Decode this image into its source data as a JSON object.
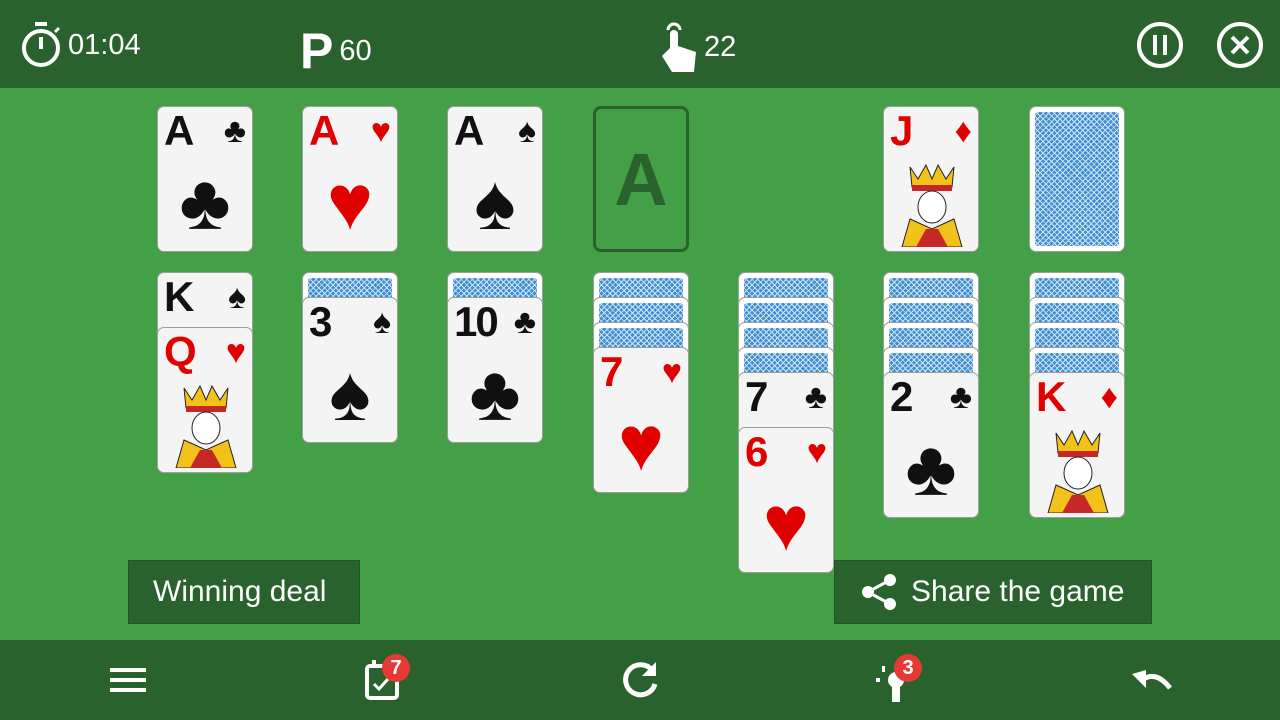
{
  "header": {
    "timer": "01:04",
    "points_label": "P",
    "points": "60",
    "moves": "22"
  },
  "foundations": [
    {
      "rank": "A",
      "suit": "♣",
      "color": "black"
    },
    {
      "rank": "A",
      "suit": "♥",
      "color": "red"
    },
    {
      "rank": "A",
      "suit": "♠",
      "color": "black"
    },
    {
      "empty": true,
      "label": "A"
    }
  ],
  "waste": {
    "rank": "J",
    "suit": "♦",
    "color": "red",
    "face": true
  },
  "stock": {
    "face_down": true
  },
  "tableau": [
    {
      "down": 0,
      "up": [
        {
          "rank": "K",
          "suit": "♠",
          "color": "black"
        },
        {
          "rank": "Q",
          "suit": "♥",
          "color": "red",
          "face": true
        }
      ]
    },
    {
      "down": 1,
      "up": [
        {
          "rank": "3",
          "suit": "♠",
          "color": "black"
        }
      ]
    },
    {
      "down": 1,
      "up": [
        {
          "rank": "10",
          "suit": "♣",
          "color": "black"
        }
      ]
    },
    {
      "down": 3,
      "up": [
        {
          "rank": "7",
          "suit": "♥",
          "color": "red"
        }
      ]
    },
    {
      "down": 4,
      "up": [
        {
          "rank": "7",
          "suit": "♣",
          "color": "black"
        },
        {
          "rank": "6",
          "suit": "♥",
          "color": "red"
        }
      ]
    },
    {
      "down": 4,
      "up": [
        {
          "rank": "2",
          "suit": "♣",
          "color": "black"
        }
      ]
    },
    {
      "down": 4,
      "up": [
        {
          "rank": "K",
          "suit": "♦",
          "color": "red",
          "face": true
        }
      ]
    }
  ],
  "buttons": {
    "winning_deal": "Winning deal",
    "share": "Share the game"
  },
  "bottom": {
    "daily_badge": "7",
    "hint_badge": "3"
  },
  "colors": {
    "felt": "#43a047",
    "bar": "#2a622d",
    "red": "#e00000",
    "badge": "#e53935"
  }
}
